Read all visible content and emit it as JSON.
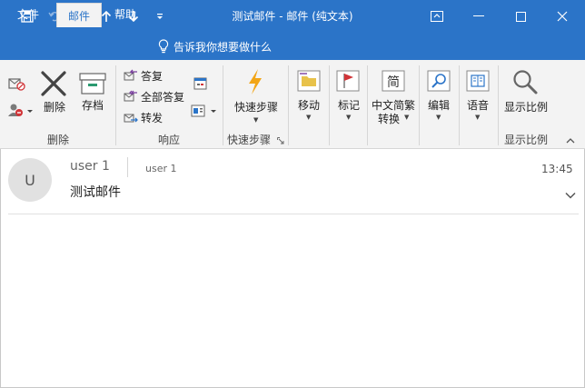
{
  "window": {
    "title": "测试邮件 - 邮件 (纯文本)"
  },
  "quick_access": {
    "icons": [
      "save-icon",
      "undo-icon",
      "redo-icon",
      "arrow-up-icon",
      "arrow-down-icon",
      "customize-icon"
    ]
  },
  "tabs": [
    {
      "label": "文件"
    },
    {
      "label": "邮件"
    },
    {
      "label": "帮助"
    }
  ],
  "tell_me": {
    "label": "告诉我你想要做什么"
  },
  "ribbon": {
    "delete_group": {
      "label": "删除",
      "delete_label": "删除",
      "archive_label": "存档"
    },
    "respond_group": {
      "label": "响应",
      "reply": "答复",
      "reply_all": "全部答复",
      "forward": "转发"
    },
    "quicksteps_group": {
      "label": "快速步骤",
      "quicksteps": "快速步骤"
    },
    "move": "移动",
    "tag": "标记",
    "chinese_conv_line1": "中文简繁",
    "chinese_conv_line2": "转换",
    "chinese_conv_icon_char": "简",
    "edit": "编辑",
    "language": "语音",
    "zoom_group": {
      "label": "显示比例",
      "zoom": "显示比例"
    }
  },
  "message": {
    "avatar_initial": "U",
    "sender": "user 1",
    "to": "user 1",
    "time": "13:45",
    "subject": "测试邮件"
  },
  "colors": {
    "accent": "#2b74c8",
    "ribbon_bg": "#f3f3f3",
    "flag": "#d13438",
    "quickstep": "#f2a516"
  }
}
